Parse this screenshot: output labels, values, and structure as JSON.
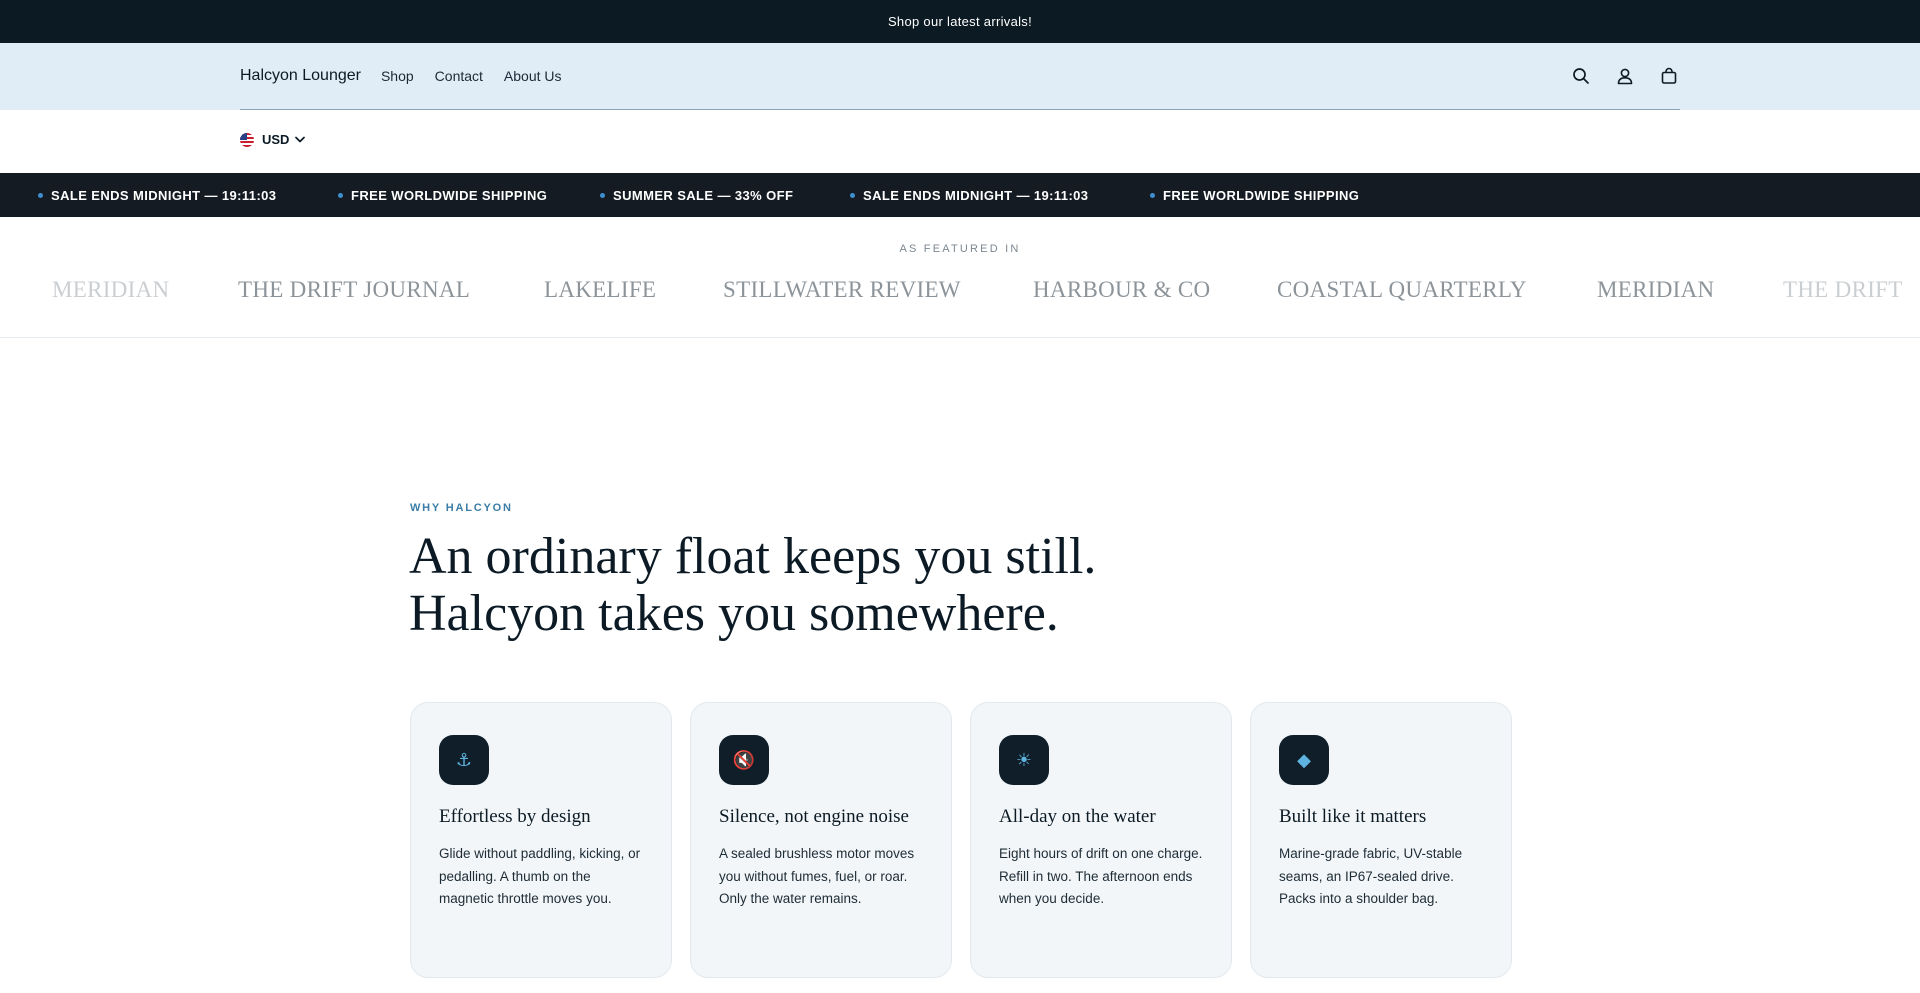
{
  "announcement": "Shop our latest arrivals!",
  "header": {
    "brand": "Halcyon Lounger",
    "nav": [
      "Shop",
      "Contact",
      "About Us"
    ],
    "icons": [
      "search-icon",
      "account-icon",
      "cart-icon"
    ]
  },
  "currency": {
    "flag": "us-flag-icon",
    "code": "USD"
  },
  "ticker": [
    "SALE ENDS MIDNIGHT —  19:11:03",
    "FREE WORLDWIDE SHIPPING",
    "SUMMER SALE — 33% OFF",
    "SALE ENDS MIDNIGHT —  19:11:03",
    "FREE WORLDWIDE SHIPPING"
  ],
  "featured": {
    "label": "AS FEATURED IN",
    "logos": [
      "MERIDIAN",
      "THE DRIFT JOURNAL",
      "LAKELIFE",
      "STILLWATER REVIEW",
      "HARBOUR & CO",
      "COASTAL QUARTERLY",
      "MERIDIAN",
      "THE DRIFT"
    ]
  },
  "why": {
    "eyebrow": "WHY HALCYON",
    "headline_line1": "An ordinary float keeps you still.",
    "headline_line2": "Halcyon takes you somewhere."
  },
  "cards": [
    {
      "icon": "⚓",
      "icon_name": "anchor-icon",
      "title": "Effortless by design",
      "text": "Glide without paddling, kicking, or pedalling. A thumb on the magnetic throttle moves you."
    },
    {
      "icon": "🔇",
      "icon_name": "muted-speaker-icon",
      "title": "Silence, not engine noise",
      "text": "A sealed brushless motor moves you without fumes, fuel, or roar. Only the water remains."
    },
    {
      "icon": "☀",
      "icon_name": "sun-icon",
      "title": "All-day on the water",
      "text": "Eight hours of drift on one charge. Refill in two. The afternoon ends when you decide."
    },
    {
      "icon": "◆",
      "icon_name": "diamond-icon",
      "title": "Built like it matters",
      "text": "Marine-grade fabric, UV-stable seams, an IP67-sealed drive. Packs into a shoulder bag."
    }
  ],
  "colors": {
    "dark": "#0c1a24",
    "header_bg": "#e1edf6",
    "accent": "#3b7da6",
    "ticker_dot": "#3f8fd0"
  }
}
